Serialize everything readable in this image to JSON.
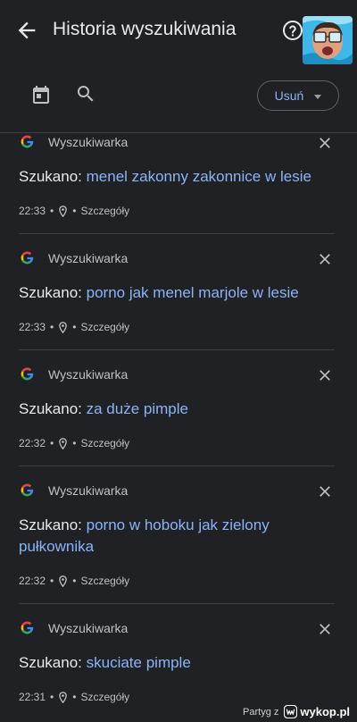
{
  "header": {
    "title": "Historia wyszukiwania",
    "back_icon": "arrow-left-icon",
    "help_icon": "help-circle-icon"
  },
  "toolbar": {
    "calendar_icon": "calendar-icon",
    "search_icon": "search-icon",
    "delete_label": "Usuń"
  },
  "entries": [
    {
      "source": "Wyszukiwarka",
      "prefix": "Szukano:",
      "query": "menel zakonny zakonnice w lesie",
      "time": "22:33",
      "sep1": "•",
      "sep2": "•",
      "details": "Szczegóły"
    },
    {
      "source": "Wyszukiwarka",
      "prefix": "Szukano:",
      "query": "porno jak menel marjole w lesie",
      "time": "22:33",
      "sep1": "•",
      "sep2": "•",
      "details": "Szczegóły"
    },
    {
      "source": "Wyszukiwarka",
      "prefix": "Szukano:",
      "query": "za duże pimple",
      "time": "22:32",
      "sep1": "•",
      "sep2": "•",
      "details": "Szczegóły"
    },
    {
      "source": "Wyszukiwarka",
      "prefix": "Szukano:",
      "query": "porno w hoboku jak zielony pułkownika",
      "time": "22:32",
      "sep1": "•",
      "sep2": "•",
      "details": "Szczegóły"
    },
    {
      "source": "Wyszukiwarka",
      "prefix": "Szukano:",
      "query": "skuciate pimple",
      "time": "22:31",
      "sep1": "•",
      "sep2": "•",
      "details": "Szczegóły"
    }
  ],
  "footer": {
    "user": "Partyg",
    "user_suffix": "z",
    "site": "wykop.pl"
  },
  "colors": {
    "background": "#202124",
    "accent": "#8ab4f8",
    "text": "#e8eaed",
    "muted": "#bdc1c6"
  }
}
